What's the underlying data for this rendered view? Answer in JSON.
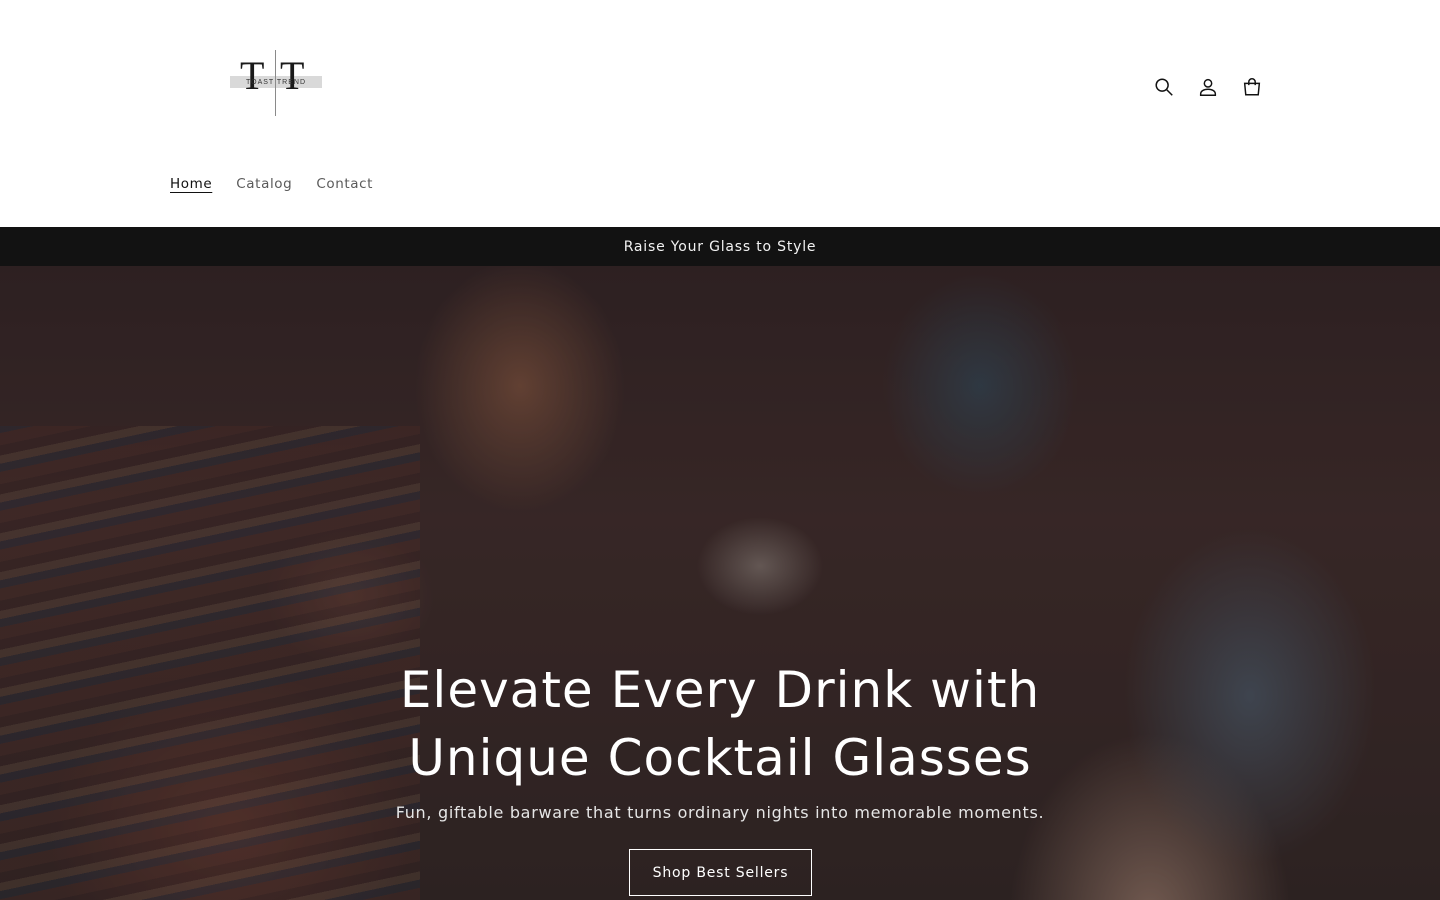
{
  "logo": {
    "letters_left": "T",
    "letters_right": "T",
    "text": "TOAST TREND"
  },
  "header": {
    "icons": {
      "search": "search-icon",
      "account": "account-icon",
      "cart": "cart-icon"
    }
  },
  "nav": {
    "items": [
      {
        "label": "Home",
        "active": true
      },
      {
        "label": "Catalog",
        "active": false
      },
      {
        "label": "Contact",
        "active": false
      }
    ]
  },
  "announcement": {
    "text": "Raise Your Glass to Style"
  },
  "hero": {
    "title": "Elevate Every Drink with Unique Cocktail Glasses",
    "subtitle": "Fun, giftable barware that turns ordinary nights into memorable moments.",
    "cta_label": "Shop Best Sellers"
  },
  "colors": {
    "announcement_bg": "#121212",
    "text": "#121212",
    "hero_text": "#ffffff"
  }
}
